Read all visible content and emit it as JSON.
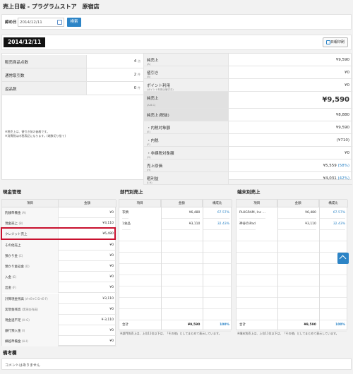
{
  "page_title": "売上日報 - プラグラムストア　原宿店",
  "filter": {
    "label": "締め日",
    "value": "2014/12/11",
    "search_label": "検索"
  },
  "date_badge": "2014/12/11",
  "print_label": "日報印刷",
  "summary_left": [
    {
      "label": "販売商品点数",
      "value": "4",
      "unit": "点"
    },
    {
      "label": "通常取引数",
      "value": "2",
      "unit": "件"
    },
    {
      "label": "返品数",
      "value": "0",
      "unit": "件"
    }
  ],
  "summary_note": [
    "※税売上は、値引き前の価格です。",
    "※消費税は内税表記になります。(端数切り捨て)"
  ],
  "summary_right": [
    {
      "label": "純売上",
      "sub": "(A)",
      "value": "¥9,590"
    },
    {
      "label": "値引き",
      "sub": "(B)",
      "value": "¥0"
    },
    {
      "label": "ポイント利用",
      "sub": "(ポイント利用は値引き)",
      "value": "¥0"
    },
    {
      "label": "純売上",
      "sub": "(A-B-C)",
      "value": "¥9,590"
    },
    {
      "label": "純売上(税抜)",
      "sub": "",
      "value": "¥8,880"
    },
    {
      "label": "・内税対象額",
      "sub": "(E)",
      "value": "¥9,590"
    },
    {
      "label": "・内税",
      "sub": "(F)",
      "value": "(¥710)"
    },
    {
      "label": "・非課税対象額",
      "sub": "(G)",
      "value": "¥0"
    },
    {
      "label": "売上原価",
      "sub": "(H)",
      "value": "¥5,559",
      "pct": "(58%)"
    },
    {
      "label": "粗利益",
      "sub": "(I-H)",
      "value": "¥4,031",
      "pct": "(42%)"
    }
  ],
  "cash": {
    "title": "現金管理",
    "headers": [
      "項目",
      "金額"
    ],
    "rows": [
      {
        "name": "釣銭準備金",
        "sub": "(A)",
        "value": "¥0"
      },
      {
        "name": "現金売上",
        "sub": "(B)",
        "value": "¥3,110"
      },
      {
        "name": "クレジット売上",
        "sub": "",
        "value": "¥6,480"
      },
      {
        "name": "その他売上",
        "sub": "",
        "value": "¥0"
      },
      {
        "name": "預かり金",
        "sub": "(C)",
        "value": "¥0"
      },
      {
        "name": "預かり金返金",
        "sub": "(D)",
        "value": "¥0"
      },
      {
        "name": "入金",
        "sub": "(E)",
        "value": "¥0"
      },
      {
        "name": "出金",
        "sub": "(F)",
        "value": "¥0"
      },
      {
        "name": "計算現金残高",
        "sub": "(A+B+C-D+E-F)",
        "value": "¥3,110"
      },
      {
        "name": "実現金残高",
        "sub": "(実現金残高)",
        "value": "¥0"
      },
      {
        "name": "現金過不足",
        "sub": "(H-G)",
        "value": "¥-3,110"
      },
      {
        "name": "銀行預入金",
        "sub": "(I)",
        "value": "¥0"
      },
      {
        "name": "繰越準備金",
        "sub": "(H-I)",
        "value": "¥0"
      }
    ]
  },
  "dept": {
    "title": "部門別売上",
    "headers": [
      "項目",
      "金額",
      "構成比"
    ],
    "rows": [
      {
        "name": "衣類",
        "value": "¥6,480",
        "pct": "67.57%"
      },
      {
        "name": "1食品",
        "value": "¥3,110",
        "pct": "32.43%"
      }
    ],
    "total": {
      "name": "合計",
      "value": "¥9,590",
      "pct": "100%"
    },
    "note": "※部門別売上は、上位11位以下は、「その他」としてまとめて表示しています。"
  },
  "terminal": {
    "title": "端末別売上",
    "headers": [
      "項目",
      "金額",
      "構成比"
    ],
    "rows": [
      {
        "name": "PLUGRAM, Inc …",
        "value": "¥6,480",
        "pct": "67.57%"
      },
      {
        "name": "神谷のiPad",
        "value": "¥3,110",
        "pct": "32.43%"
      }
    ],
    "total": {
      "name": "合計",
      "value": "¥9,590",
      "pct": "100%"
    },
    "note": "※端末別売上は、上位11位以下は、「その他」としてまとめて表示しています。"
  },
  "remarks": {
    "title": "備考欄",
    "text": "コメントはありません"
  },
  "colors": {
    "accent": "#2c84c6",
    "highlight": "#c8102e"
  }
}
